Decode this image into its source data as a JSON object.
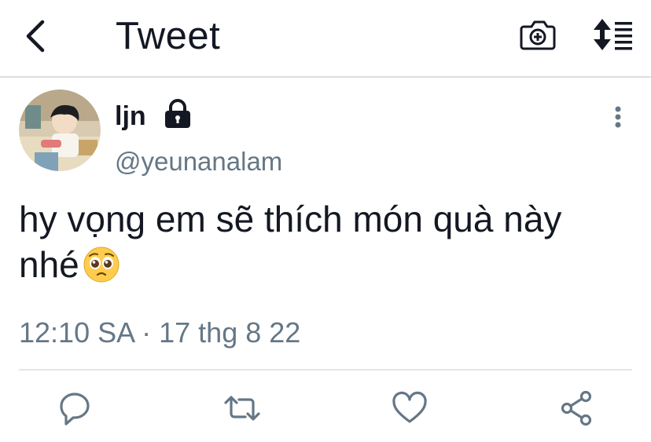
{
  "header": {
    "title": "Tweet",
    "icons": [
      "back-chevron-icon",
      "camera-icon",
      "sort-icon"
    ]
  },
  "tweet": {
    "author": {
      "display_name": "ljn",
      "username": "@yeunanalam",
      "protected": true
    },
    "text_line1": "hy vọng em sẽ thích món quà này",
    "text_line2": "nhé",
    "emoji": "pleading-face",
    "timestamp": "12:10 SA · 17 thg 8 22"
  },
  "actions": [
    "reply-icon",
    "retweet-icon",
    "like-icon",
    "share-icon"
  ],
  "colors": {
    "text": "#141823",
    "secondary": "#657786",
    "divider": "#e1e8ed"
  }
}
